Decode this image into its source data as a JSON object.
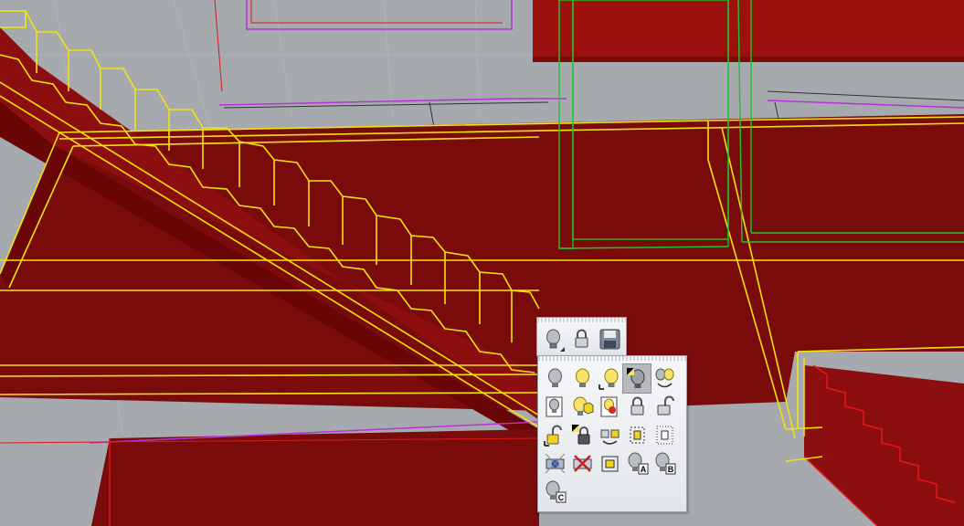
{
  "viewport": {
    "background_color": "#a6a9ad",
    "object_color_dark_red": "#7a0b0b",
    "object_color_red": "#9c1010",
    "highlight_yellow": "#f2e30c",
    "layer_green": "#1dc82a",
    "layer_magenta": "#b832d6",
    "layer_red_line": "#d81a1a"
  },
  "small_toolbar": {
    "buttons": [
      {
        "id": "light-bulb",
        "icon": "bulb-off-icon",
        "flyout": true
      },
      {
        "id": "lock",
        "icon": "lock-icon",
        "flyout": false
      },
      {
        "id": "save",
        "icon": "floppy-disk-icon",
        "flyout": false
      }
    ]
  },
  "large_toolbar": {
    "buttons": [
      {
        "id": "hide-objects",
        "icon": "bulb-off-icon"
      },
      {
        "id": "show-objects",
        "icon": "bulb-on-icon"
      },
      {
        "id": "show-selected",
        "icon": "bulb-on-corner-icon"
      },
      {
        "id": "swap-hidden",
        "icon": "bulb-half-icon",
        "active": true
      },
      {
        "id": "swap-visibility",
        "icon": "bulb-swap-icon"
      },
      {
        "id": "hide-in-detail",
        "icon": "page-bulb-off-icon"
      },
      {
        "id": "show-in-detail",
        "icon": "bulb-cube-icon"
      },
      {
        "id": "show-selected-in-detail",
        "icon": "page-bulb-red-icon"
      },
      {
        "id": "lock-objects",
        "icon": "lock-icon"
      },
      {
        "id": "unlock-objects",
        "icon": "unlock-icon"
      },
      {
        "id": "unlock-selected",
        "icon": "unlock-yellow-icon"
      },
      {
        "id": "swap-locked",
        "icon": "lock-half-icon"
      },
      {
        "id": "swap-lock",
        "icon": "lock-swap-icon"
      },
      {
        "id": "hide-points",
        "icon": "points-cage-icon"
      },
      {
        "id": "show-points",
        "icon": "points-cage-dotted-icon"
      },
      {
        "id": "hide-blocks",
        "icon": "block-blue-icon"
      },
      {
        "id": "hide-disabled",
        "icon": "block-cross-icon"
      },
      {
        "id": "select-locked",
        "icon": "lock-frame-icon"
      },
      {
        "id": "named-state-a",
        "icon": "bulb-a-icon"
      },
      {
        "id": "named-state-b",
        "icon": "bulb-b-icon"
      },
      {
        "id": "named-state-c",
        "icon": "bulb-c-icon"
      }
    ],
    "badges": {
      "a": "A",
      "b": "B",
      "c": "C"
    }
  }
}
